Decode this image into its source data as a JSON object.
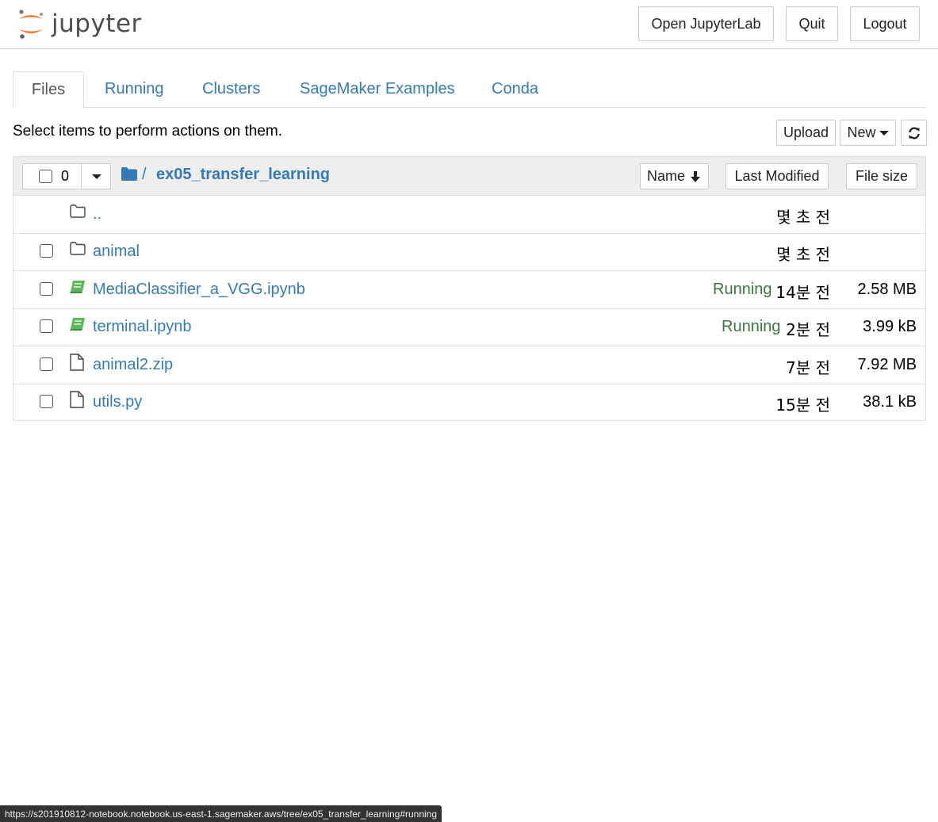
{
  "header": {
    "logo_text": "jupyter",
    "buttons": {
      "open_lab": "Open JupyterLab",
      "quit": "Quit",
      "logout": "Logout"
    }
  },
  "tabs": [
    {
      "label": "Files",
      "active": true
    },
    {
      "label": "Running",
      "active": false
    },
    {
      "label": "Clusters",
      "active": false
    },
    {
      "label": "SageMaker Examples",
      "active": false
    },
    {
      "label": "Conda",
      "active": false
    }
  ],
  "toolbar": {
    "hint": "Select items to perform actions on them.",
    "upload_label": "Upload",
    "new_label": "New",
    "refresh_icon": "refresh-icon"
  },
  "list_header": {
    "selected_count": "0",
    "breadcrumb_sep": "/",
    "folder_name": "ex05_transfer_learning",
    "sort_name": "Name",
    "sort_modified": "Last Modified",
    "sort_size": "File size"
  },
  "files": [
    {
      "name": "..",
      "type": "folder",
      "running": "",
      "modified": "몇 초 전",
      "size": ""
    },
    {
      "name": "animal",
      "type": "folder",
      "running": "",
      "modified": "몇 초 전",
      "size": ""
    },
    {
      "name": "MediaClassifier_a_VGG.ipynb",
      "type": "notebook",
      "running": "Running",
      "modified": "14분 전",
      "size": "2.58 MB"
    },
    {
      "name": "terminal.ipynb",
      "type": "notebook",
      "running": "Running",
      "modified": "2분 전",
      "size": "3.99 kB"
    },
    {
      "name": "animal2.zip",
      "type": "file",
      "running": "",
      "modified": "7분 전",
      "size": "7.92 MB"
    },
    {
      "name": "utils.py",
      "type": "file",
      "running": "",
      "modified": "15분 전",
      "size": "38.1 kB"
    }
  ],
  "status_url": "https://s201910812-notebook.notebook.us-east-1.sagemaker.aws/tree/ex05_transfer_learning#running",
  "colors": {
    "link": "#337ab7",
    "running": "#3c763d",
    "notebook_icon": "#5cb85c",
    "logo_orange": "#f37726"
  }
}
